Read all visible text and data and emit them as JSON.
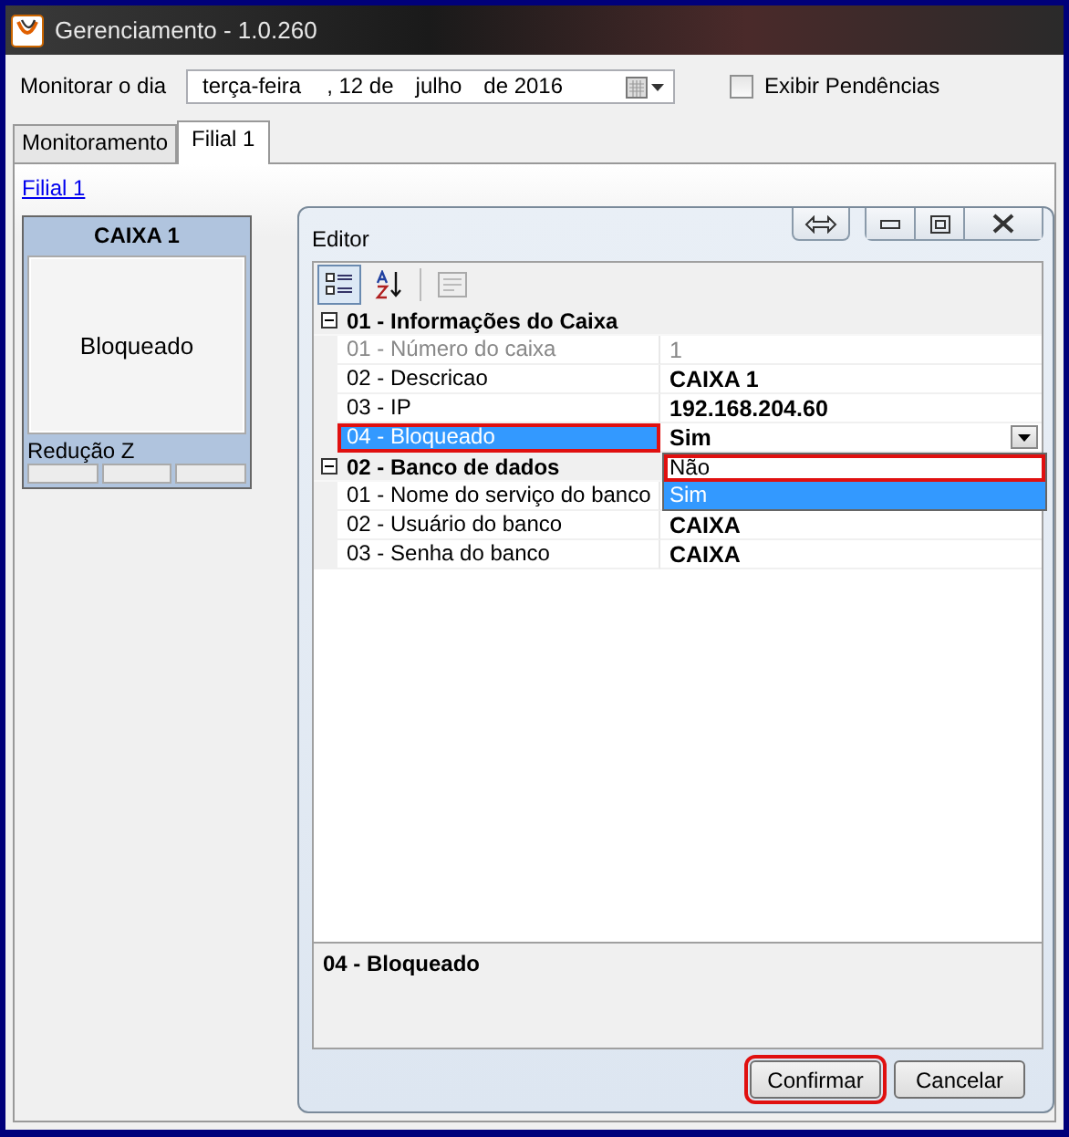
{
  "window": {
    "title": "Gerenciamento - 1.0.260"
  },
  "toolbar": {
    "date_label": "Monitorar o dia",
    "date_parts": [
      "terça-feira",
      ", 12 de",
      "julho",
      "de 2016"
    ],
    "checkbox": {
      "label": "Exibir Pendências",
      "checked": false
    }
  },
  "tabs": [
    {
      "label": "Monitoramento",
      "selected": false
    },
    {
      "label": "Filial 1",
      "selected": true
    }
  ],
  "branch_link": "Filial 1",
  "cashier_card": {
    "title": "CAIXA 1",
    "status": "Bloqueado",
    "reduction_label": "Redução Z"
  },
  "editor": {
    "title": "Editor",
    "categories": [
      {
        "title": "01 - Informações do Caixa",
        "expanded": true,
        "properties": [
          {
            "name": "01 - Número do caixa",
            "value": "1",
            "disabled": true,
            "selected": false,
            "highlighted": false
          },
          {
            "name": "02 - Descricao",
            "value": "CAIXA 1",
            "disabled": false,
            "selected": false,
            "highlighted": false
          },
          {
            "name": "03 - IP",
            "value": "192.168.204.60",
            "disabled": false,
            "selected": false,
            "highlighted": false
          },
          {
            "name": "04 - Bloqueado",
            "value": "Sim",
            "disabled": false,
            "selected": true,
            "highlighted": true
          }
        ]
      },
      {
        "title": "02 - Banco de dados",
        "expanded": true,
        "properties": [
          {
            "name": "01 - Nome do serviço do banco",
            "disabled": false,
            "selected": false,
            "highlighted": false
          },
          {
            "name": "02 - Usuário do banco",
            "value": "CAIXA",
            "disabled": false,
            "selected": false,
            "highlighted": false
          },
          {
            "name": "03 - Senha do banco",
            "value": "CAIXA",
            "disabled": false,
            "selected": false,
            "highlighted": false
          }
        ]
      }
    ],
    "dropdown": {
      "options": [
        {
          "label": "Não",
          "selected": false,
          "highlighted": true
        },
        {
          "label": "Sim",
          "selected": true,
          "highlighted": false
        }
      ]
    },
    "description": "04 - Bloqueado",
    "buttons": [
      {
        "label": "Confirmar",
        "highlighted": true
      },
      {
        "label": "Cancelar",
        "highlighted": false
      }
    ]
  }
}
